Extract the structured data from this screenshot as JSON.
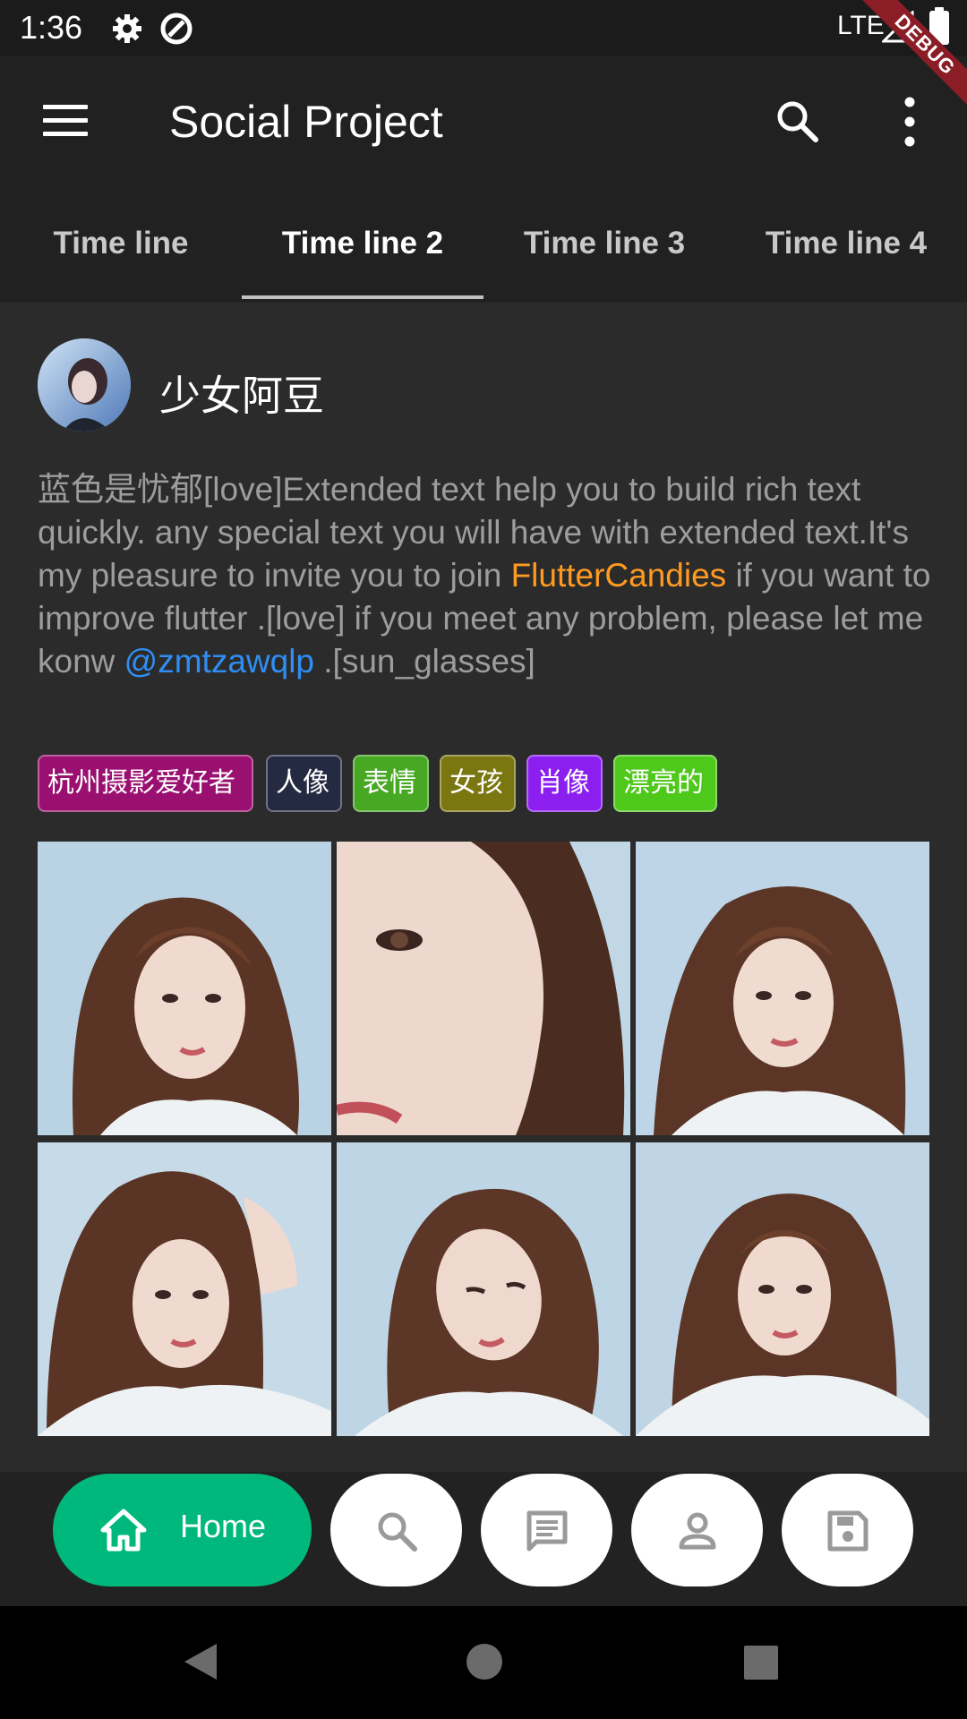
{
  "status_bar": {
    "time": "1:36",
    "network": "LTE"
  },
  "debug_banner": "DEBUG",
  "app_bar": {
    "title": "Social Project"
  },
  "tabs": [
    {
      "label": "Time line",
      "active": false
    },
    {
      "label": "Time line 2",
      "active": true
    },
    {
      "label": "Time line 3",
      "active": false
    },
    {
      "label": "Time line 4",
      "active": false
    }
  ],
  "post": {
    "username": "少女阿豆",
    "text_parts": {
      "p1": "蓝色是忧郁[love]Extended text help you to build rich text quickly. any special text you will have with extended text.It's my pleasure to invite you to join ",
      "link1": "FlutterCandies",
      "p2": " if you want to improve flutter .[love] if you meet any problem, please let me konw ",
      "link2": "@zmtzawqlp",
      "p3": " .[sun_glasses]"
    },
    "tags": [
      {
        "label": "杭州摄影爱好者",
        "color": "#9a1070"
      },
      {
        "label": "人像",
        "color": "#242a42"
      },
      {
        "label": "表情",
        "color": "#47a824"
      },
      {
        "label": "女孩",
        "color": "#7a7710"
      },
      {
        "label": "肖像",
        "color": "#8c1ff0"
      },
      {
        "label": "漂亮的",
        "color": "#4fc81c"
      }
    ],
    "photo_count": 6
  },
  "bottom_nav": {
    "active_label": "Home",
    "accent": "#00b87c",
    "items": [
      "home-icon",
      "search-icon",
      "message-icon",
      "person-icon",
      "save-icon"
    ]
  }
}
